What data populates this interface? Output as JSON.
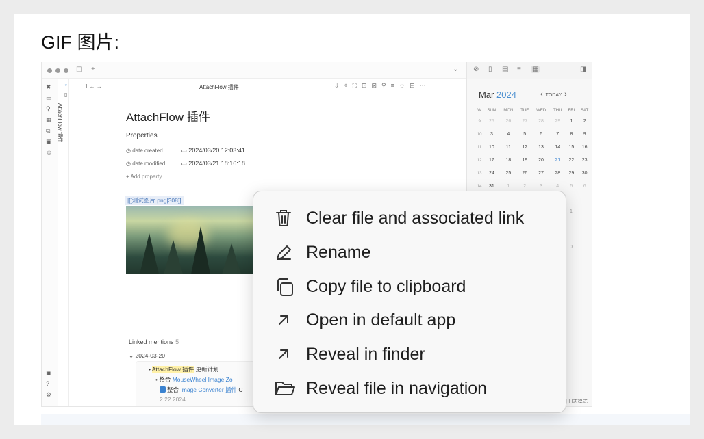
{
  "page_heading": "GIF 图片:",
  "app": {
    "tab_title": "AttachFlow 插件",
    "vertical_tab_label": "AttachFlow 插件",
    "nav_text": "1 ←  →",
    "doc": {
      "title": "AttachFlow 插件",
      "properties_label": "Properties",
      "properties": [
        {
          "name": "date created",
          "value": "2024/03/20 12:03:41"
        },
        {
          "name": "date modified",
          "value": "2024/03/21 18:16:18"
        }
      ],
      "add_property": "+ Add property",
      "embed_link": "|[[测试图片.png|308]]",
      "linked_mentions_label": "Linked mentions",
      "linked_mentions_count": "5",
      "mention_date": "2024-03-20",
      "mention_lines": {
        "line1_prefix": "• ",
        "line1_highlight": "AttachFlow 插件",
        "line1_rest": " 更新计划",
        "line2_prefix": "• 整合 ",
        "line2_link": "MouseWheel Image Zo",
        "line3_prefix": "整合 ",
        "line3_link": "Image Converter 插件",
        "line3_rest": " C",
        "line4": "                2.22 2024"
      }
    },
    "calendar": {
      "month": "Mar",
      "year": "2024",
      "today_label": "TODAY",
      "prev_arrow": "‹",
      "next_arrow": "›",
      "weekday_headers": [
        "W",
        "SUN",
        "MON",
        "TUE",
        "WED",
        "THU",
        "FRI",
        "SAT"
      ],
      "rows": [
        [
          "9",
          "25",
          "26",
          "27",
          "28",
          "29",
          "1",
          "2"
        ],
        [
          "10",
          "3",
          "4",
          "5",
          "6",
          "7",
          "8",
          "9"
        ],
        [
          "11",
          "10",
          "11",
          "12",
          "13",
          "14",
          "15",
          "16"
        ],
        [
          "12",
          "17",
          "18",
          "19",
          "20",
          "21",
          "22",
          "23"
        ],
        [
          "13",
          "24",
          "25",
          "26",
          "27",
          "28",
          "29",
          "30"
        ],
        [
          "14",
          "31",
          "1",
          "2",
          "3",
          "4",
          "5",
          "6"
        ]
      ],
      "today": "21"
    },
    "side_numbers": [
      "1",
      "0"
    ],
    "footer_text": "| 日志模式"
  },
  "context_menu": {
    "items": [
      {
        "label": "Clear file and associated link",
        "icon": "trash-icon"
      },
      {
        "label": "Rename",
        "icon": "pencil-icon"
      },
      {
        "label": "Copy file to clipboard",
        "icon": "copy-icon"
      },
      {
        "label": "Open in default app",
        "icon": "arrow-up-right-icon"
      },
      {
        "label": "Reveal in finder",
        "icon": "arrow-up-right-icon"
      },
      {
        "label": "Reveal file in navigation",
        "icon": "folder-open-icon"
      }
    ]
  }
}
